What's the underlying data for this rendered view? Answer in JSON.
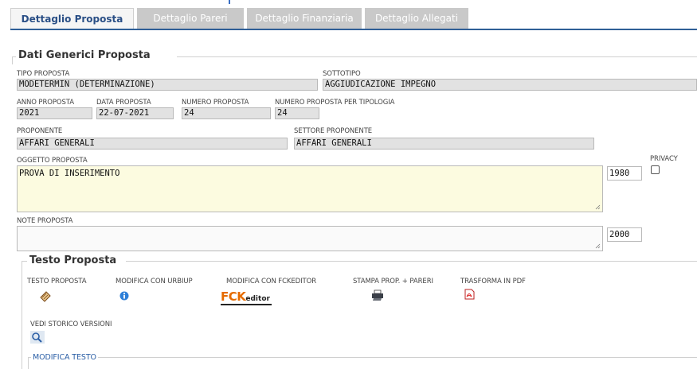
{
  "tabs": [
    {
      "label": "Dettaglio Proposta",
      "active": true
    },
    {
      "label": "Dettaglio Pareri",
      "active": false
    },
    {
      "label": "Dettaglio Finanziaria",
      "active": false
    },
    {
      "label": "Dettaglio Allegati",
      "active": false
    }
  ],
  "generic": {
    "legend": "Dati Generici Proposta",
    "tipo_label": "TIPO PROPOSTA",
    "tipo_value": "MODETERMIN (DETERMINAZIONE)",
    "sottotipo_label": "SOTTOTIPO",
    "sottotipo_value": "AGGIUDICAZIONE IMPEGNO",
    "anno_label": "ANNO PROPOSTA",
    "anno_value": "2021",
    "data_label": "DATA PROPOSTA",
    "data_value": "22-07-2021",
    "numero_label": "NUMERO PROPOSTA",
    "numero_value": "24",
    "numero_tip_label": "NUMERO PROPOSTA PER TIPOLOGIA",
    "numero_tip_value": "24",
    "proponente_label": "PROPONENTE",
    "proponente_value": "AFFARI GENERALI",
    "settore_label": "SETTORE PROPONENTE",
    "settore_value": "AFFARI GENERALI",
    "oggetto_label": "OGGETTO PROPOSTA",
    "oggetto_value": "PROVA DI INSERIMENTO",
    "oggetto_counter": "1980",
    "privacy_label": "PRIVACY",
    "note_label": "NOTE PROPOSTA",
    "note_value": "",
    "note_counter": "2000"
  },
  "testo": {
    "legend": "Testo Proposta",
    "actions": [
      {
        "label": "TESTO PROPOSTA",
        "icon": "document-icon"
      },
      {
        "label": "MODIFICA CON URBIUP",
        "icon": "info-icon"
      },
      {
        "label": "MODIFICA CON FCKEDITOR",
        "icon": "fckeditor-logo",
        "logo_text": "FCK",
        "logo_sub": "editor"
      },
      {
        "label": "STAMPA PROP. + PARERI",
        "icon": "printer-icon"
      },
      {
        "label": "TRASFORMA IN PDF",
        "icon": "pdf-icon"
      }
    ],
    "storico_label": "VEDI STORICO VERSIONI",
    "modifica_legend": "MODIFICA TESTO"
  }
}
